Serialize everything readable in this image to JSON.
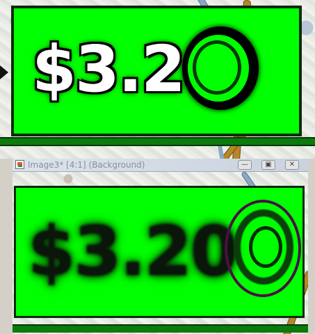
{
  "background_canvas": {
    "sign_price": "$3.20",
    "sign_color": "#00ff00",
    "baseline_color": "#0c7a0c"
  },
  "window": {
    "title": "Image3* [4:1] (Background)",
    "buttons": {
      "minimize_icon": "minimize-icon",
      "maximize_icon": "maximize-icon",
      "close_icon": "close-icon"
    },
    "canvas": {
      "sign_price": "$3.20",
      "sign_color": "#00ff00",
      "ring_color": "#4a1045"
    }
  }
}
